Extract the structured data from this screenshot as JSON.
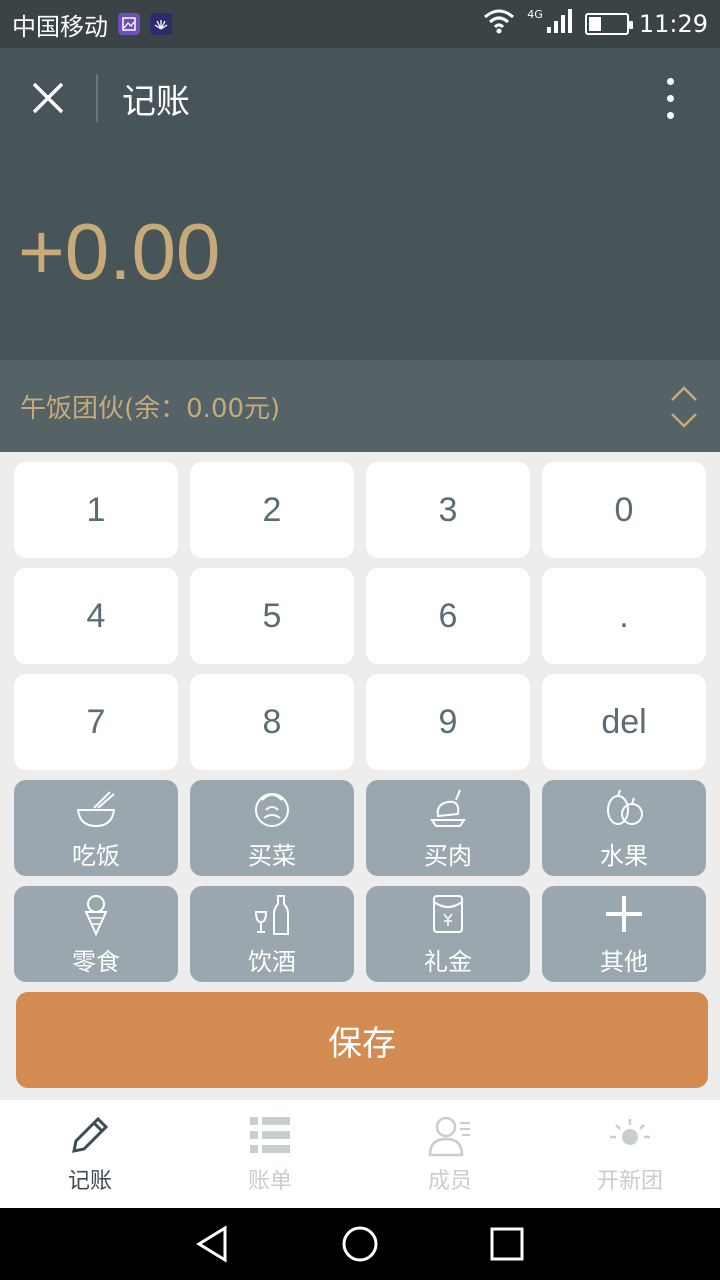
{
  "status": {
    "carrier": "中国移动",
    "network": "4G",
    "time": "11:29",
    "battery_level": 0.35
  },
  "header": {
    "title": "记账",
    "amount": "+0.00"
  },
  "group": {
    "label": "午饭团伙(余：0.00元)"
  },
  "keys": {
    "k1": "1",
    "k2": "2",
    "k3": "3",
    "k0": "0",
    "k4": "4",
    "k5": "5",
    "k6": "6",
    "dot": ".",
    "k7": "7",
    "k8": "8",
    "k9": "9",
    "del": "del"
  },
  "categories": [
    {
      "label": "吃饭",
      "icon": "bowl-icon"
    },
    {
      "label": "买菜",
      "icon": "vegetable-icon"
    },
    {
      "label": "买肉",
      "icon": "meat-icon"
    },
    {
      "label": "水果",
      "icon": "fruit-icon"
    },
    {
      "label": "零食",
      "icon": "icecream-icon"
    },
    {
      "label": "饮酒",
      "icon": "wine-icon"
    },
    {
      "label": "礼金",
      "icon": "red-envelope-icon"
    },
    {
      "label": "其他",
      "icon": "plus-icon"
    }
  ],
  "save_label": "保存",
  "tabs": [
    {
      "label": "记账",
      "icon": "pencil-icon",
      "active": true
    },
    {
      "label": "账单",
      "icon": "list-icon",
      "active": false
    },
    {
      "label": "成员",
      "icon": "members-icon",
      "active": false
    },
    {
      "label": "开新团",
      "icon": "sun-icon",
      "active": false
    }
  ],
  "colors": {
    "accent": "#c6aa79",
    "save": "#d48b52",
    "header": "#485558",
    "category": "#9aa7ae"
  }
}
